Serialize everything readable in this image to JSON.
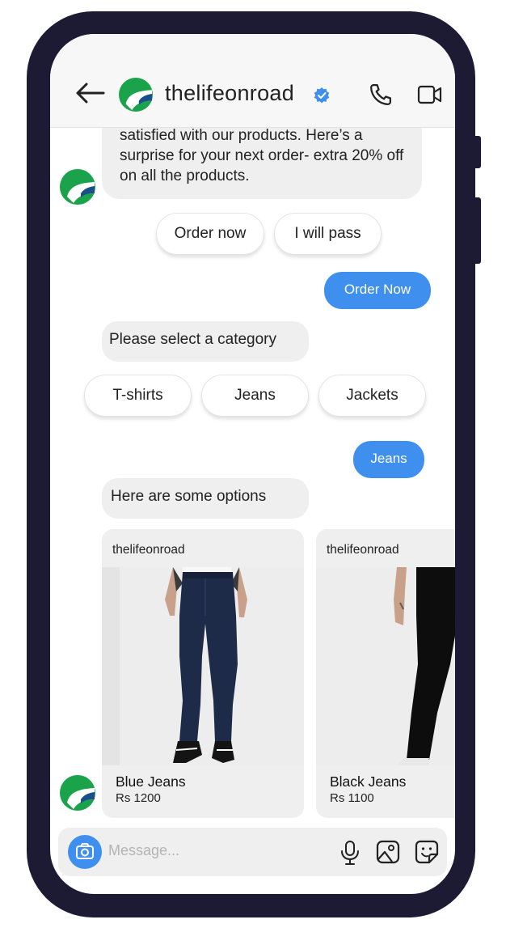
{
  "header": {
    "title": "thelifeonroad"
  },
  "messages": {
    "intro_text": "satisfied with our products. Here’s a surprise for your next order- extra 20% off on all the products.",
    "quick_replies_1": [
      "Order now",
      "I will pass"
    ],
    "user_reply_1": "Order Now",
    "select_category": "Please select a category",
    "categories": [
      "T-shirts",
      "Jeans",
      "Jackets"
    ],
    "user_reply_2": "Jeans",
    "options_text": "Here are some options"
  },
  "products": [
    {
      "brand": "thelifeonroad",
      "name": "Blue Jeans",
      "price": "Rs 1200"
    },
    {
      "brand": "thelifeonroad",
      "name": "Black Jeans",
      "price": "Rs 1100"
    }
  ],
  "composer": {
    "placeholder": "Message..."
  },
  "colors": {
    "accent": "#3f90ee",
    "frame": "#1c1b33",
    "bubble": "#efefef",
    "brand_green": "#1aa34a",
    "brand_blue": "#1b4f8a"
  },
  "icons": [
    "back-arrow-icon",
    "verified-badge-icon",
    "phone-icon",
    "video-icon",
    "camera-icon",
    "microphone-icon",
    "gallery-icon",
    "sticker-icon"
  ]
}
